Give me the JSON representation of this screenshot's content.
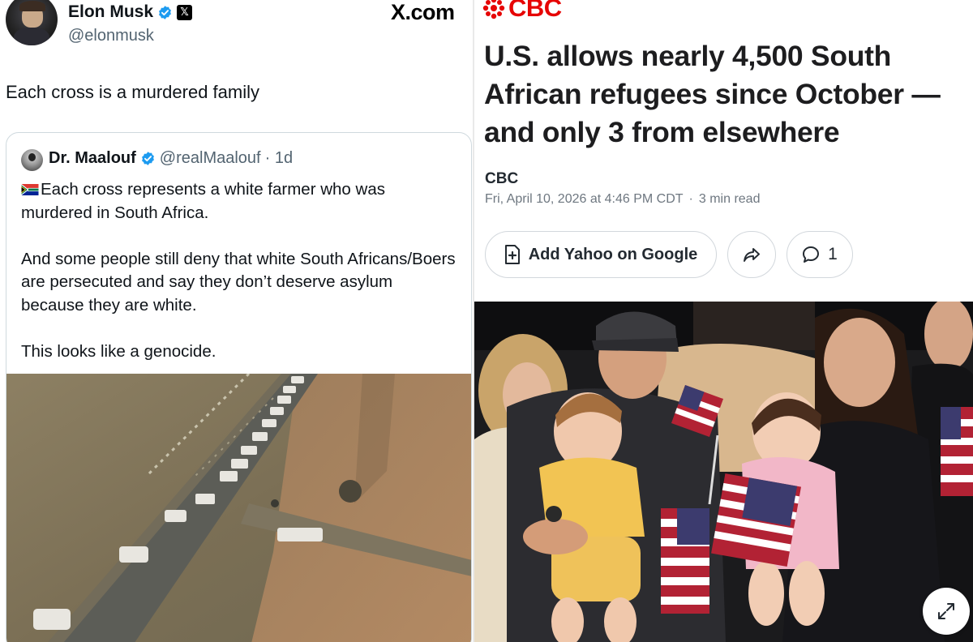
{
  "tweet": {
    "author_name": "Elon Musk",
    "author_handle": "@elonmusk",
    "site_mark": "X.com",
    "text": "Each cross is a murdered family",
    "quoted": {
      "author_name": "Dr. Maalouf",
      "author_handle": "@realMaalouf",
      "time": "· 1d",
      "paragraphs": [
        "Each cross represents a white farmer who was murdered in South Africa.",
        "And some people still deny that white South Africans/Boers are persecuted and say they don’t deserve asylum because they are white.",
        "This looks like a genocide."
      ]
    }
  },
  "article": {
    "publisher_logo": "CBC",
    "headline": "U.S. allows nearly 4,500 South African refugees since October — and only 3 from elsewhere",
    "source": "CBC",
    "date": "Fri, April 10, 2026 at 4:46 PM CDT",
    "read_time": "3 min read",
    "buttons": {
      "add_yahoo": "Add Yahoo on Google",
      "comments_count": "1"
    }
  },
  "colors": {
    "verified_blue": "#1d9bf0",
    "cbc_red": "#e60505",
    "text_dark": "#0f1419",
    "text_muted": "#536471"
  },
  "icons": [
    "verified-badge-icon",
    "x-logo-icon",
    "south-africa-flag-icon",
    "cbc-gem-icon",
    "add-page-icon",
    "share-icon",
    "comment-icon",
    "expand-icon"
  ]
}
